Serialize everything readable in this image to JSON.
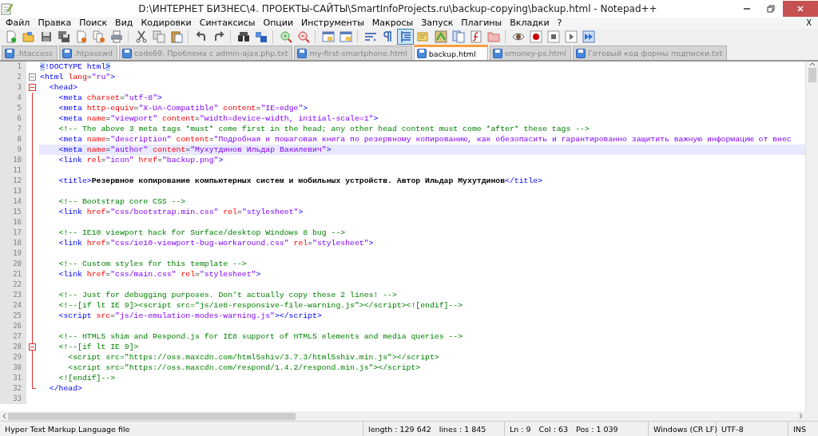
{
  "window": {
    "title": "D:\\ИНТЕРНЕТ БИЗНЕС\\4. ПРОЕКТЫ-САЙТЫ\\SmartInfoProjects.ru\\backup-copying\\backup.html - Notepad++"
  },
  "menu": {
    "items": [
      "Файл",
      "Правка",
      "Поиск",
      "Вид",
      "Кодировки",
      "Синтаксисы",
      "Опции",
      "Инструменты",
      "Макросы",
      "Запуск",
      "Плагины",
      "Вкладки",
      "?"
    ],
    "close": "X"
  },
  "toolbar": [
    {
      "kind": "button",
      "pressed": false
    },
    {
      "kind": "button",
      "pressed": false
    },
    {
      "kind": "button",
      "pressed": false
    },
    {
      "kind": "button",
      "pressed": false
    },
    {
      "kind": "button",
      "pressed": false
    },
    {
      "kind": "button",
      "pressed": false
    },
    {
      "kind": "button",
      "pressed": false
    },
    {
      "kind": "separator"
    },
    {
      "kind": "button",
      "pressed": false
    },
    {
      "kind": "button",
      "pressed": false
    },
    {
      "kind": "button",
      "pressed": false
    },
    {
      "kind": "separator"
    },
    {
      "kind": "button",
      "pressed": false
    },
    {
      "kind": "button",
      "pressed": false
    },
    {
      "kind": "separator"
    },
    {
      "kind": "button",
      "pressed": false
    },
    {
      "kind": "button",
      "pressed": false
    },
    {
      "kind": "separator"
    },
    {
      "kind": "button",
      "pressed": false
    },
    {
      "kind": "button",
      "pressed": false
    },
    {
      "kind": "separator"
    },
    {
      "kind": "button",
      "pressed": false
    },
    {
      "kind": "button",
      "pressed": false
    },
    {
      "kind": "separator"
    },
    {
      "kind": "button",
      "pressed": false
    },
    {
      "kind": "button",
      "pressed": false
    },
    {
      "kind": "button",
      "pressed": true
    },
    {
      "kind": "button",
      "pressed": false
    },
    {
      "kind": "button",
      "pressed": false
    },
    {
      "kind": "button",
      "pressed": false
    },
    {
      "kind": "button",
      "pressed": false
    },
    {
      "kind": "button",
      "pressed": false
    },
    {
      "kind": "separator"
    },
    {
      "kind": "button",
      "pressed": false
    },
    {
      "kind": "button",
      "pressed": false
    },
    {
      "kind": "button",
      "pressed": false
    },
    {
      "kind": "button",
      "pressed": false
    },
    {
      "kind": "button",
      "pressed": false
    }
  ],
  "tabs": [
    {
      "label": ".htaccess",
      "selected": false
    },
    {
      "label": ".htpasswd",
      "selected": false
    },
    {
      "label": "code69. Проблема с admin-ajax.php.txt",
      "selected": false
    },
    {
      "label": "my-first-smartphone.html",
      "selected": false
    },
    {
      "label": "backup.html",
      "selected": true
    },
    {
      "label": "emoney-ps.html",
      "selected": false
    },
    {
      "label": "Готовый код формы подписки.txt",
      "selected": false
    }
  ],
  "lines": [
    {
      "number": "1",
      "current": false,
      "tokens": [
        {
          "kind": "match",
          "text": "<"
        },
        {
          "kind": "tag",
          "text": "!DOCTYPE html"
        },
        {
          "kind": "match",
          "text": ">"
        }
      ]
    },
    {
      "number": "2",
      "current": false,
      "expanded": true,
      "tokens": [
        {
          "kind": "tag",
          "text": "<html"
        },
        {
          "kind": "attr",
          "text": " lang"
        },
        {
          "kind": "plain",
          "text": "="
        },
        {
          "kind": "value",
          "text": "\"ru\""
        },
        {
          "kind": "tag",
          "text": ">"
        }
      ]
    },
    {
      "number": "3",
      "current": false,
      "expanded": true,
      "tokens": [
        {
          "kind": "tag",
          "text": "  <head>"
        }
      ]
    },
    {
      "number": "4",
      "current": false,
      "tokens": [
        {
          "kind": "tag",
          "text": "    <meta"
        },
        {
          "kind": "attr",
          "text": " charset"
        },
        {
          "kind": "plain",
          "text": "="
        },
        {
          "kind": "value",
          "text": "\"utf-8\""
        },
        {
          "kind": "tag",
          "text": ">"
        }
      ]
    },
    {
      "number": "5",
      "current": false,
      "tokens": [
        {
          "kind": "tag",
          "text": "    <meta"
        },
        {
          "kind": "attr",
          "text": " http-equiv"
        },
        {
          "kind": "plain",
          "text": "="
        },
        {
          "kind": "value",
          "text": "\"X-UA-Compatible\""
        },
        {
          "kind": "attr",
          "text": " content"
        },
        {
          "kind": "plain",
          "text": "="
        },
        {
          "kind": "value",
          "text": "\"IE=edge\""
        },
        {
          "kind": "tag",
          "text": ">"
        }
      ]
    },
    {
      "number": "6",
      "current": false,
      "tokens": [
        {
          "kind": "tag",
          "text": "    <meta"
        },
        {
          "kind": "attr",
          "text": " name"
        },
        {
          "kind": "plain",
          "text": "="
        },
        {
          "kind": "value",
          "text": "\"viewport\""
        },
        {
          "kind": "attr",
          "text": " content"
        },
        {
          "kind": "plain",
          "text": "="
        },
        {
          "kind": "value",
          "text": "\"width=device-width, initial-scale=1\""
        },
        {
          "kind": "tag",
          "text": ">"
        }
      ]
    },
    {
      "number": "7",
      "current": false,
      "tokens": [
        {
          "kind": "comment",
          "text": "    <!-- The above 3 meta tags *must* come first in the head; any other head content must come *after* these tags -->"
        }
      ]
    },
    {
      "number": "8",
      "current": false,
      "tokens": [
        {
          "kind": "tag",
          "text": "    <meta"
        },
        {
          "kind": "attr",
          "text": " name"
        },
        {
          "kind": "plain",
          "text": "="
        },
        {
          "kind": "value",
          "text": "\"description\""
        },
        {
          "kind": "attr",
          "text": " content"
        },
        {
          "kind": "plain",
          "text": "="
        },
        {
          "kind": "value",
          "text": "\"Подробная и пошаговая книга по резервному копированию, как обезопасить и гарантированно защитить важную информацию от внес"
        }
      ]
    },
    {
      "number": "9",
      "current": true,
      "tokens": [
        {
          "kind": "tag",
          "text": "    <meta"
        },
        {
          "kind": "attr",
          "text": " name"
        },
        {
          "kind": "plain",
          "text": "="
        },
        {
          "kind": "value",
          "text": "\"author\""
        },
        {
          "kind": "attr",
          "text": " content"
        },
        {
          "kind": "plain",
          "text": "="
        },
        {
          "kind": "value",
          "text": "\"Мухутдинов Ильдар Вакилевич\""
        },
        {
          "kind": "tag",
          "text": ">"
        }
      ]
    },
    {
      "number": "10",
      "current": false,
      "tokens": [
        {
          "kind": "tag",
          "text": "    <link"
        },
        {
          "kind": "attr",
          "text": " rel"
        },
        {
          "kind": "plain",
          "text": "="
        },
        {
          "kind": "value",
          "text": "\"icon\""
        },
        {
          "kind": "attr",
          "text": " href"
        },
        {
          "kind": "plain",
          "text": "="
        },
        {
          "kind": "value",
          "text": "\"backup.png\""
        },
        {
          "kind": "tag",
          "text": ">"
        }
      ]
    },
    {
      "number": "11",
      "current": false
    },
    {
      "number": "12",
      "current": false,
      "tokens": [
        {
          "kind": "tag",
          "text": "    <title>"
        },
        {
          "kind": "text",
          "text": "Резервное копирование компьютерных систем и мобильных устройств. Автор Ильдар Мухутдинов"
        },
        {
          "kind": "tag",
          "text": "</title>"
        }
      ]
    },
    {
      "number": "13",
      "current": false
    },
    {
      "number": "14",
      "current": false,
      "tokens": [
        {
          "kind": "comment",
          "text": "    <!-- Bootstrap core CSS -->"
        }
      ]
    },
    {
      "number": "15",
      "current": false,
      "tokens": [
        {
          "kind": "tag",
          "text": "    <link"
        },
        {
          "kind": "attr",
          "text": " href"
        },
        {
          "kind": "plain",
          "text": "="
        },
        {
          "kind": "value",
          "text": "\"css/bootstrap.min.css\""
        },
        {
          "kind": "attr",
          "text": " rel"
        },
        {
          "kind": "plain",
          "text": "="
        },
        {
          "kind": "value",
          "text": "\"stylesheet\""
        },
        {
          "kind": "tag",
          "text": ">"
        }
      ]
    },
    {
      "number": "16",
      "current": false
    },
    {
      "number": "17",
      "current": false,
      "tokens": [
        {
          "kind": "comment",
          "text": "    <!-- IE10 viewport hack for Surface/desktop Windows 8 bug -->"
        }
      ]
    },
    {
      "number": "18",
      "current": false,
      "tokens": [
        {
          "kind": "tag",
          "text": "    <link"
        },
        {
          "kind": "attr",
          "text": " href"
        },
        {
          "kind": "plain",
          "text": "="
        },
        {
          "kind": "value",
          "text": "\"css/ie10-viewport-bug-workaround.css\""
        },
        {
          "kind": "attr",
          "text": " rel"
        },
        {
          "kind": "plain",
          "text": "="
        },
        {
          "kind": "value",
          "text": "\"stylesheet\""
        },
        {
          "kind": "tag",
          "text": ">"
        }
      ]
    },
    {
      "number": "19",
      "current": false
    },
    {
      "number": "20",
      "current": false,
      "tokens": [
        {
          "kind": "comment",
          "text": "    <!-- Custom styles for this template -->"
        }
      ]
    },
    {
      "number": "21",
      "current": false,
      "tokens": [
        {
          "kind": "tag",
          "text": "    <link"
        },
        {
          "kind": "attr",
          "text": " href"
        },
        {
          "kind": "plain",
          "text": "="
        },
        {
          "kind": "value",
          "text": "\"css/main.css\""
        },
        {
          "kind": "attr",
          "text": " rel"
        },
        {
          "kind": "plain",
          "text": "="
        },
        {
          "kind": "value",
          "text": "\"stylesheet\""
        },
        {
          "kind": "tag",
          "text": ">"
        }
      ]
    },
    {
      "number": "22",
      "current": false
    },
    {
      "number": "23",
      "current": false,
      "tokens": [
        {
          "kind": "comment",
          "text": "    <!-- Just for debugging purposes. Don't actually copy these 2 lines! -->"
        }
      ]
    },
    {
      "number": "24",
      "current": false,
      "tokens": [
        {
          "kind": "comment",
          "text": "    <!--[if lt IE 9]><script src=\"js/ie8-responsive-file-warning.js\"></script><![endif]-->"
        }
      ]
    },
    {
      "number": "25",
      "current": false,
      "tokens": [
        {
          "kind": "tag",
          "text": "    <script"
        },
        {
          "kind": "attr",
          "text": " src"
        },
        {
          "kind": "plain",
          "text": "="
        },
        {
          "kind": "value",
          "text": "\"js/ie-emulation-modes-warning.js\""
        },
        {
          "kind": "tag",
          "text": "></script>"
        }
      ]
    },
    {
      "number": "26",
      "current": false
    },
    {
      "number": "27",
      "current": false,
      "tokens": [
        {
          "kind": "comment",
          "text": "    <!-- HTML5 shim and Respond.js for IE8 support of HTML5 elements and media queries -->"
        }
      ]
    },
    {
      "number": "28",
      "current": false,
      "expanded": true,
      "tokens": [
        {
          "kind": "comment",
          "text": "    <!--[if lt IE 9]>"
        }
      ]
    },
    {
      "number": "29",
      "current": false,
      "tokens": [
        {
          "kind": "comment",
          "text": "      <script src=\"https://oss.maxcdn.com/html5shiv/3.7.3/html5shiv.min.js\"></script>"
        }
      ]
    },
    {
      "number": "30",
      "current": false,
      "tokens": [
        {
          "kind": "comment",
          "text": "      <script src=\"https://oss.maxcdn.com/respond/1.4.2/respond.min.js\"></script>"
        }
      ]
    },
    {
      "number": "31",
      "current": false,
      "tokens": [
        {
          "kind": "comment",
          "text": "    <![endif]-->"
        }
      ]
    },
    {
      "number": "32",
      "current": false,
      "tokens": [
        {
          "kind": "tag",
          "text": "  </head>"
        }
      ]
    },
    {
      "number": "33",
      "current": false
    }
  ],
  "status_bar": {
    "file_type": "Hyper Text Markup Language file",
    "length": "length : 129 642",
    "lines": "lines : 1 845",
    "ln": "Ln : 9",
    "col": "Col : 63",
    "pos": "Pos : 1 039",
    "eol": "Windows (CR LF)",
    "encoding": "UTF-8",
    "mode": "INS"
  }
}
